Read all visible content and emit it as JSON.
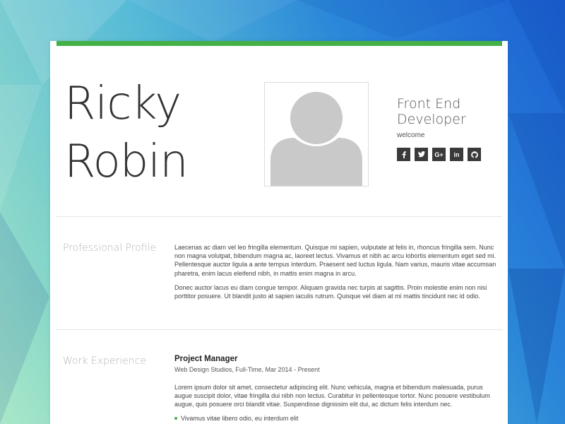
{
  "colors": {
    "accent": "#45b046",
    "background_start": "#a9e8c8",
    "background_end": "#1b5fd3",
    "social_button": "#3a3a3a"
  },
  "header": {
    "first_name": "Ricky",
    "last_name": "Robin",
    "role": "Front End Developer",
    "welcome": "welcome",
    "avatar_icon": "user-silhouette-icon",
    "social": [
      {
        "icon": "facebook-icon",
        "glyph": "f"
      },
      {
        "icon": "twitter-icon",
        "glyph": "t"
      },
      {
        "icon": "google-plus-icon",
        "glyph": "G+"
      },
      {
        "icon": "linkedin-icon",
        "glyph": "in"
      },
      {
        "icon": "github-icon",
        "glyph": "gh"
      }
    ]
  },
  "profile": {
    "label": "Professional Profile",
    "paragraphs": [
      "Laecenas ac diam vel leo fringilla elementum. Quisque mi sapien, vulputate at felis in, rhoncus fringilla sem. Nunc non magna volutpat, bibendum magna ac, laoreet lectus. Vivamus et nibh ac arcu lobortis elementum eget sed mi. Pellentesque auctor ligula a ante tempus interdum. Praesent sed luctus ligula. Nam varius, mauris vitae accumsan pharetra, enim lacus eleifend nibh, in mattis enim magna in arcu.",
      "Donec auctor lacus eu diam congue tempor. Aliquam gravida nec turpis at sagittis. Proin molestie enim non nisi porttitor posuere. Ut blandit justo at sapien iaculis rutrum. Quisque vel diam at mi mattis tincidunt nec id odio."
    ]
  },
  "experience": {
    "label": "Work Experience",
    "jobs": [
      {
        "title": "Project Manager",
        "meta": "Web Design Studios, Full-Time, Mar 2014 - Present",
        "description": "Lorem ipsum dolor sit amet, consectetur adipiscing elit. Nunc vehicula, magna et bibendum malesuada, purus augue suscipit dolor, vitae fringilla dui nibh non lectus. Curabitur in pellentesque tortor. Nunc posuere vestibulum augue, quis posuere orci blandit vitae. Suspendisse dignissim elit dui, ac dictum felis interdum nec.",
        "bullets": [
          "Vivamus vitae libero odio, eu interdum elit"
        ]
      }
    ]
  }
}
